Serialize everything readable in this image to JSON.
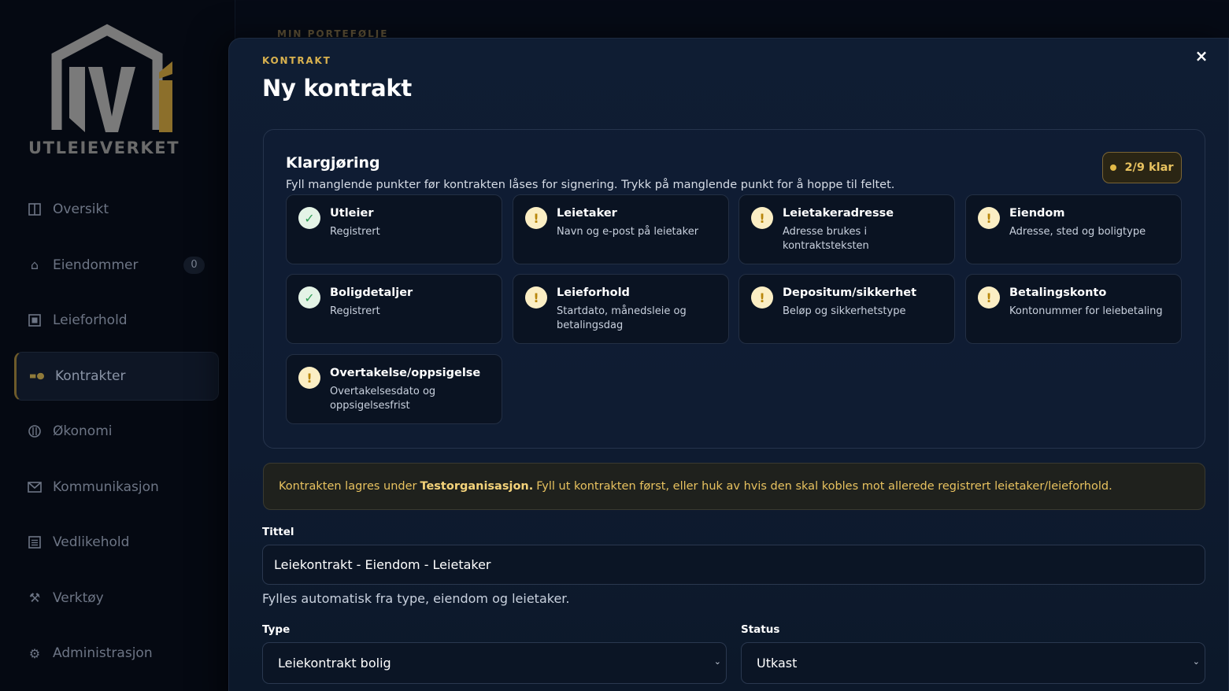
{
  "sidebar": {
    "logo_text": "UTLEIEVERKET",
    "items": [
      {
        "label": "Oversikt",
        "icon": "columns-icon"
      },
      {
        "label": "Eiendommer",
        "icon": "home-icon",
        "badge": "0"
      },
      {
        "label": "Leieforhold",
        "icon": "square-icon"
      },
      {
        "label": "Kontrakter",
        "icon": "toggle-icon",
        "active": true
      },
      {
        "label": "Økonomi",
        "icon": "coin-icon"
      },
      {
        "label": "Kommunikasjon",
        "icon": "mail-icon"
      },
      {
        "label": "Vedlikehold",
        "icon": "list-icon"
      },
      {
        "label": "Verktøy",
        "icon": "tools-icon"
      },
      {
        "label": "Administrasjon",
        "icon": "gear-icon"
      }
    ]
  },
  "background": {
    "eyebrow": "MIN PORTEFØLJE"
  },
  "modal": {
    "eyebrow": "KONTRAKT",
    "title": "Ny kontrakt",
    "close_label": "×",
    "readiness": {
      "title": "Klargjøring",
      "description": "Fyll manglende punkter før kontrakten låses for signering. Trykk på manglende punkt for å hoppe til feltet.",
      "status": "2/9 klar",
      "items": [
        {
          "title": "Utleier",
          "sub": "Registrert",
          "state": "ok"
        },
        {
          "title": "Leietaker",
          "sub": "Navn og e-post på leietaker",
          "state": "warn"
        },
        {
          "title": "Leietakeradresse",
          "sub": "Adresse brukes i kontraktsteksten",
          "state": "warn"
        },
        {
          "title": "Eiendom",
          "sub": "Adresse, sted og boligtype",
          "state": "warn"
        },
        {
          "title": "Boligdetaljer",
          "sub": "Registrert",
          "state": "ok"
        },
        {
          "title": "Leieforhold",
          "sub": "Startdato, månedsleie og betalingsdag",
          "state": "warn"
        },
        {
          "title": "Depositum/sikkerhet",
          "sub": "Beløp og sikkerhetstype",
          "state": "warn"
        },
        {
          "title": "Betalingskonto",
          "sub": "Kontonummer for leiebetaling",
          "state": "warn"
        },
        {
          "title": "Overtakelse/oppsigelse",
          "sub": "Overtakelsesdato og oppsigelsesfrist",
          "state": "warn"
        }
      ]
    },
    "notice": {
      "before": "Kontrakten lagres under",
      "org": "Testorganisasjon.",
      "after": "Fyll ut kontrakten først, eller huk av hvis den skal kobles mot allerede registrert leietaker/leieforhold."
    },
    "form": {
      "title_label": "Tittel",
      "title_value": "Leiekontrakt - Eiendom - Leietaker",
      "title_hint": "Fylles automatisk fra type, eiendom og leietaker.",
      "type_label": "Type",
      "type_value": "Leiekontrakt bolig",
      "status_label": "Status",
      "status_value": "Utkast"
    }
  },
  "colors": {
    "accent": "#d9b24f",
    "ok": "#2f9e56",
    "warn": "#b8860b"
  }
}
